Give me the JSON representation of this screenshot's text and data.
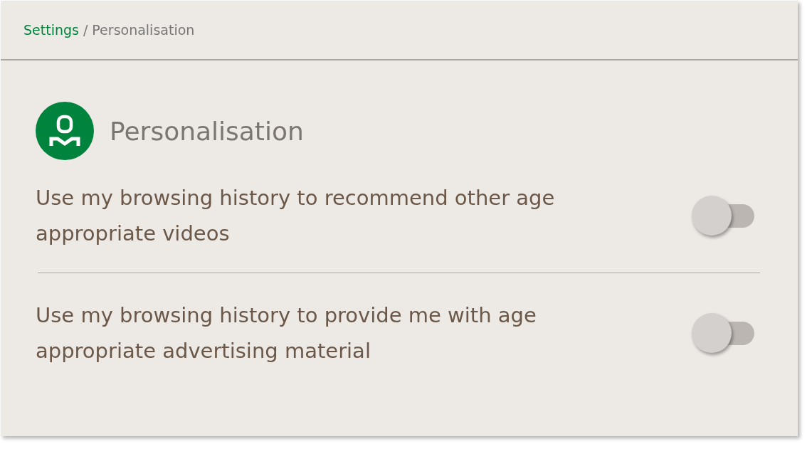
{
  "breadcrumb": {
    "parent": "Settings",
    "separator": "/",
    "current": "Personalisation"
  },
  "section": {
    "title": "Personalisation"
  },
  "options": [
    {
      "label": "Use my browsing history to recommend other age appropriate videos",
      "on": false
    },
    {
      "label": "Use my browsing history to provide me with age appropriate advertising material",
      "on": false
    }
  ]
}
